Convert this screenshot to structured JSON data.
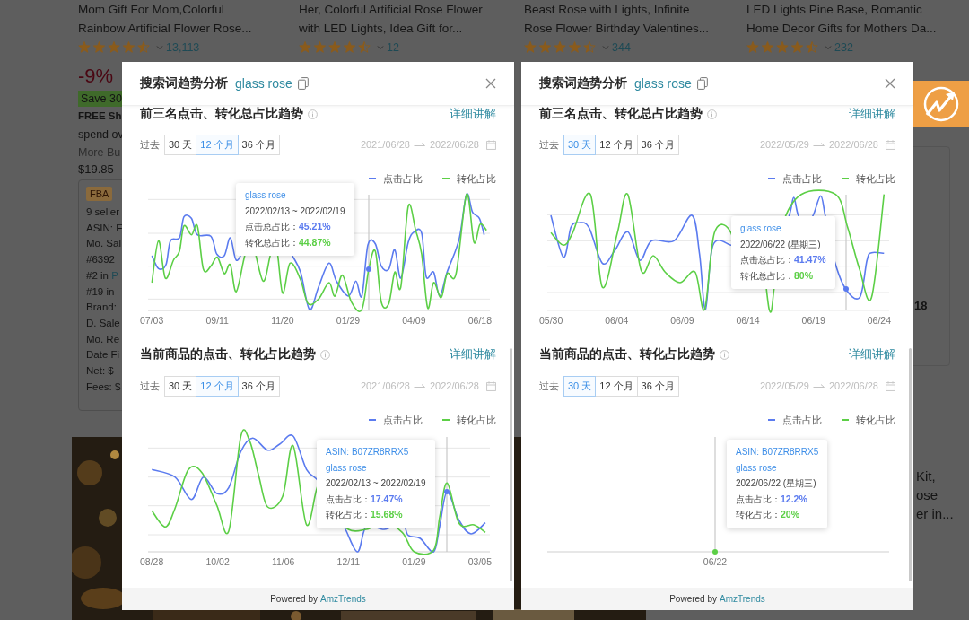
{
  "background": {
    "products": [
      {
        "title_lines": [
          "Mom Gift For Mom,Colorful",
          "Rainbow Artificial Flower Rose..."
        ],
        "stars": 4.5,
        "review_count": "13,113"
      },
      {
        "title_lines": [
          "Her, Colorful Artificial Rose Flower",
          "with LED Lights, Idea Gift for..."
        ],
        "stars": 4.5,
        "review_count": "12"
      },
      {
        "title_lines": [
          "Beast Rose with Lights, Infinite",
          "Rose Flower Birthday Valentines..."
        ],
        "stars": 4.5,
        "review_count": "344"
      },
      {
        "title_lines": [
          "LED Lights Pine Base, Romantic",
          "Home Decor Gifts for Mothers Da..."
        ],
        "stars": 4.5,
        "review_count": "232"
      }
    ],
    "offer": {
      "discount": "-9%",
      "save": "Save 30",
      "shipping": "FREE Sh",
      "shipping_note": "spend ov",
      "more_buying": "More Bu",
      "price": "$19.85",
      "badge": "FBA",
      "details": [
        {
          "text": "9 seller"
        },
        {
          "text": "ASIN: E"
        },
        {
          "text": "Mo. Sal"
        },
        {
          "text": "#6392"
        },
        {
          "text": "#2 in",
          "link": "P"
        },
        {
          "text": "#19 in"
        },
        {
          "text": "Brand:"
        },
        {
          "text": "D. Sale"
        },
        {
          "text": "Mo. Re"
        },
        {
          "text": "Date Fi"
        },
        {
          "text": "Net:  $"
        },
        {
          "text": "Fees:  $"
        }
      ]
    },
    "side_rank": "18",
    "side_title_lines": [
      "Kit,",
      "ose",
      "er in..."
    ]
  },
  "panels": [
    {
      "title": "搜索词趋势分析",
      "keyword": "glass rose",
      "sections": [
        {
          "title": "前三名点击、转化总占比趋势",
          "link": "详细讲解",
          "range_label": "过去",
          "ranges": [
            {
              "label": "30 天",
              "selected": false
            },
            {
              "label": "12 个月",
              "selected": true
            },
            {
              "label": "36 个月",
              "selected": false
            }
          ],
          "date_from": "2021/06/28",
          "date_to": "2022/06/28",
          "legend": [
            {
              "label": "点击占比",
              "color": "#5b7bef"
            },
            {
              "label": "转化占比",
              "color": "#5ccf46"
            }
          ],
          "x_labels": [
            "07/03",
            "09/11",
            "11/20",
            "01/29",
            "04/09",
            "06/18"
          ],
          "tooltip": {
            "keyword": "glass rose",
            "date": "2022/02/13 ~ 2022/02/19",
            "rows": [
              {
                "label": "点击总占比：",
                "value": "45.21%",
                "color": "#5b7bef"
              },
              {
                "label": "转化总占比：",
                "value": "44.87%",
                "color": "#5ccf46"
              }
            ]
          }
        },
        {
          "title": "当前商品的点击、转化占比趋势",
          "link": "详细讲解",
          "range_label": "过去",
          "ranges": [
            {
              "label": "30 天",
              "selected": false
            },
            {
              "label": "12 个月",
              "selected": true
            },
            {
              "label": "36 个月",
              "selected": false
            }
          ],
          "date_from": "2021/06/28",
          "date_to": "2022/06/28",
          "legend": [
            {
              "label": "点击占比",
              "color": "#5b7bef"
            },
            {
              "label": "转化占比",
              "color": "#5ccf46"
            }
          ],
          "x_labels": [
            "08/28",
            "10/02",
            "11/06",
            "12/11",
            "01/29",
            "03/05"
          ],
          "tooltip": {
            "asin": "ASIN: B07ZR8RRX5",
            "keyword": "glass rose",
            "date": "2022/02/13 ~ 2022/02/19",
            "rows": [
              {
                "label": "点击占比：",
                "value": "17.47%",
                "color": "#5b7bef"
              },
              {
                "label": "转化占比：",
                "value": "15.68%",
                "color": "#5ccf46"
              }
            ]
          }
        }
      ],
      "footer": {
        "prefix": "Powered by",
        "brand": "AmzTrends"
      }
    },
    {
      "title": "搜索词趋势分析",
      "keyword": "glass rose",
      "sections": [
        {
          "title": "前三名点击、转化总占比趋势",
          "link": "详细讲解",
          "range_label": "过去",
          "ranges": [
            {
              "label": "30 天",
              "selected": true
            },
            {
              "label": "12 个月",
              "selected": false
            },
            {
              "label": "36 个月",
              "selected": false
            }
          ],
          "date_from": "2022/05/29",
          "date_to": "2022/06/28",
          "legend": [
            {
              "label": "点击占比",
              "color": "#5b7bef"
            },
            {
              "label": "转化占比",
              "color": "#5ccf46"
            }
          ],
          "x_labels": [
            "05/30",
            "06/04",
            "06/09",
            "06/14",
            "06/19",
            "06/24"
          ],
          "tooltip": {
            "keyword": "glass rose",
            "date": "2022/06/22 (星期三)",
            "rows": [
              {
                "label": "点击总占比：",
                "value": "41.47%",
                "color": "#5b7bef"
              },
              {
                "label": "转化总占比：",
                "value": "80%",
                "color": "#5ccf46"
              }
            ]
          }
        },
        {
          "title": "当前商品的点击、转化占比趋势",
          "link": "详细讲解",
          "range_label": "过去",
          "ranges": [
            {
              "label": "30 天",
              "selected": true
            },
            {
              "label": "12 个月",
              "selected": false
            },
            {
              "label": "36 个月",
              "selected": false
            }
          ],
          "date_from": "2022/05/29",
          "date_to": "2022/06/28",
          "legend": [
            {
              "label": "点击占比",
              "color": "#5b7bef"
            },
            {
              "label": "转化占比",
              "color": "#5ccf46"
            }
          ],
          "x_labels": [
            "06/22"
          ],
          "tooltip": {
            "asin": "ASIN: B07ZR8RRX5",
            "keyword": "glass rose",
            "date": "2022/06/22 (星期三)",
            "rows": [
              {
                "label": "点击占比：",
                "value": "12.2%",
                "color": "#5b7bef"
              },
              {
                "label": "转化占比：",
                "value": "20%",
                "color": "#5ccf46"
              }
            ]
          }
        }
      ],
      "footer": {
        "prefix": "Powered by",
        "brand": "AmzTrends"
      }
    }
  ]
}
